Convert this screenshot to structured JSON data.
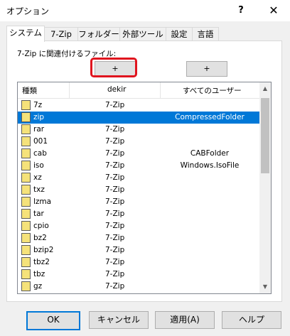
{
  "window": {
    "title": "オプション",
    "help_glyph": "?",
    "close_glyph": "✕"
  },
  "tabs": [
    {
      "label": "システム"
    },
    {
      "label": "7-Zip"
    },
    {
      "label": "フォルダー"
    },
    {
      "label": "外部ツール"
    },
    {
      "label": "設定"
    },
    {
      "label": "言語"
    }
  ],
  "association": {
    "label": "7-Zip に関連付けるファイル:",
    "plus_user": "+",
    "plus_all": "+"
  },
  "list": {
    "columns": [
      "種類",
      "dekir",
      "すべてのユーザー"
    ],
    "rows": [
      {
        "ext": "7z",
        "user": "7-Zip",
        "all": ""
      },
      {
        "ext": "zip",
        "user": "",
        "all": "CompressedFolder"
      },
      {
        "ext": "rar",
        "user": "7-Zip",
        "all": ""
      },
      {
        "ext": "001",
        "user": "7-Zip",
        "all": ""
      },
      {
        "ext": "cab",
        "user": "7-Zip",
        "all": "CABFolder"
      },
      {
        "ext": "iso",
        "user": "7-Zip",
        "all": "Windows.IsoFile"
      },
      {
        "ext": "xz",
        "user": "7-Zip",
        "all": ""
      },
      {
        "ext": "txz",
        "user": "7-Zip",
        "all": ""
      },
      {
        "ext": "lzma",
        "user": "7-Zip",
        "all": ""
      },
      {
        "ext": "tar",
        "user": "7-Zip",
        "all": ""
      },
      {
        "ext": "cpio",
        "user": "7-Zip",
        "all": ""
      },
      {
        "ext": "bz2",
        "user": "7-Zip",
        "all": ""
      },
      {
        "ext": "bzip2",
        "user": "7-Zip",
        "all": ""
      },
      {
        "ext": "tbz2",
        "user": "7-Zip",
        "all": ""
      },
      {
        "ext": "tbz",
        "user": "7-Zip",
        "all": ""
      },
      {
        "ext": "gz",
        "user": "7-Zip",
        "all": ""
      }
    ],
    "selected_row": 1
  },
  "buttons": {
    "ok": "OK",
    "cancel": "キャンセル",
    "apply": "適用(A)",
    "help": "ヘルプ"
  }
}
